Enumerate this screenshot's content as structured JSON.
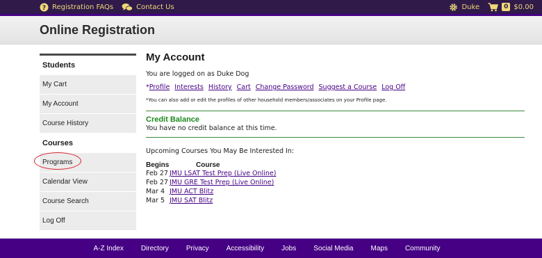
{
  "topbar": {
    "faqs_label": "Registration FAQs",
    "contact_label": "Contact Us",
    "user_label": "Duke",
    "cart_count": "0",
    "cart_total": "$0.00",
    "accent_color": "#f0d878"
  },
  "banner": {
    "title": "Online Registration"
  },
  "sidebar": {
    "students_heading": "Students",
    "courses_heading": "Courses",
    "student_items": [
      {
        "label": "My Cart"
      },
      {
        "label": "My Account"
      },
      {
        "label": "Course History"
      }
    ],
    "course_items": [
      {
        "label": "Programs"
      },
      {
        "label": "Calendar View"
      },
      {
        "label": "Course Search"
      },
      {
        "label": "Log Off"
      }
    ]
  },
  "main": {
    "title": "My Account",
    "logged_in_text": "You are logged on as Duke Dog",
    "links_prefix": "*",
    "links": [
      "Profile",
      "Interests",
      "History",
      "Cart",
      "Change Password",
      "Suggest a Course",
      "Log Off"
    ],
    "note": "*You can also add or edit the profiles of other household members/associates on your Profile page.",
    "credit_title": "Credit Balance",
    "credit_text": "You have no credit balance at this time.",
    "upcoming_label": "Upcoming Courses You May Be Interested In:",
    "course_headers": {
      "begins": "Begins",
      "course": "Course"
    },
    "courses": [
      {
        "date": "Feb 27",
        "title": "JMU LSAT Test Prep (Live Online)"
      },
      {
        "date": "Feb 27",
        "title": "JMU GRE Test Prep (Live Online)"
      },
      {
        "date": "Mar 4",
        "title": "JMU ACT Blitz"
      },
      {
        "date": "Mar 5",
        "title": "JMU SAT Blitz"
      }
    ]
  },
  "footer": {
    "links": [
      "A-Z Index",
      "Directory",
      "Privacy",
      "Accessibility",
      "Jobs",
      "Social Media",
      "Maps",
      "Community"
    ]
  },
  "colors": {
    "brand_purple": "#450084",
    "topbar_bg": "#2f1a4a",
    "credit_green": "#1d8a1d",
    "highlight_ring": "#d9232e"
  },
  "icons": [
    "question-circle-icon",
    "chat-bubbles-icon",
    "gear-icon",
    "cart-icon"
  ]
}
